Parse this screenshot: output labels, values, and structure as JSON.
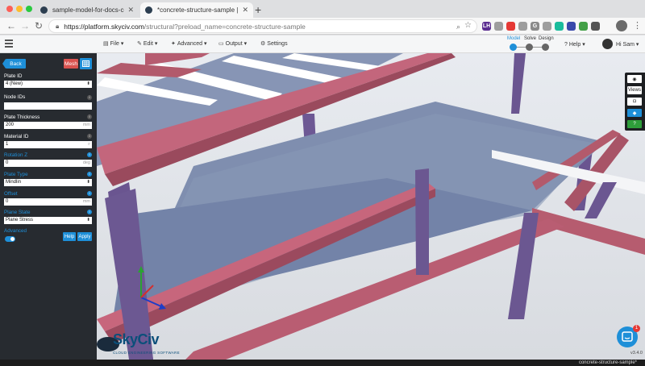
{
  "browser": {
    "tabs": [
      {
        "title": "sample-model-for-docs-concrete",
        "active": false
      },
      {
        "title": "*concrete-structure-sample | SkyCiv",
        "active": true
      }
    ],
    "url_host": "https://platform.skyciv.com",
    "url_path": "/structural?preload_name=concrete-structure-sample",
    "extensions": [
      {
        "label": "LH",
        "color": "#5b2d90"
      },
      {
        "label": "",
        "color": "#9e9e9e"
      },
      {
        "label": "",
        "color": "#e53935"
      },
      {
        "label": "",
        "color": "#9e9e9e"
      },
      {
        "label": "G",
        "color": "#8a8a8a"
      },
      {
        "label": "",
        "color": "#9e9e9e"
      },
      {
        "label": "",
        "color": "#1abc9c"
      },
      {
        "label": "",
        "color": "#3949ab"
      },
      {
        "label": "",
        "color": "#43a047"
      },
      {
        "label": "",
        "color": "#555555"
      }
    ]
  },
  "app": {
    "menus": [
      {
        "icon": "file-icon",
        "glyph": "▤",
        "label": "File"
      },
      {
        "icon": "edit-icon",
        "glyph": "✎",
        "label": "Edit"
      },
      {
        "icon": "wrench-icon",
        "glyph": "✦",
        "label": "Advanced"
      },
      {
        "icon": "monitor-icon",
        "glyph": "▭",
        "label": "Output"
      },
      {
        "icon": "gear-icon",
        "glyph": "⚙",
        "label": "Settings"
      }
    ],
    "modes": [
      {
        "label": "Model",
        "active": true
      },
      {
        "label": "Solve",
        "active": false
      },
      {
        "label": "Design",
        "active": false
      }
    ],
    "help_label": "Help",
    "user_label": "Hi Sam"
  },
  "panel": {
    "back_label": "Back",
    "mesh_label": "Mesh",
    "fields": {
      "plate_id": {
        "label": "Plate ID",
        "value": "4 (New)"
      },
      "node_ids": {
        "label": "Node IDs",
        "value": ""
      },
      "plate_thickness": {
        "label": "Plate Thickness",
        "value": "200",
        "unit": "mm"
      },
      "material_id": {
        "label": "Material ID",
        "value": "1"
      },
      "rotation_z": {
        "label": "Rotation Z",
        "value": "0",
        "unit": "deg"
      },
      "plate_type": {
        "label": "Plate Type",
        "value": "Mindlin"
      },
      "offset": {
        "label": "Offset",
        "value": "0",
        "unit": "mm"
      },
      "plane_state": {
        "label": "Plane State",
        "value": "Plane Stress"
      }
    },
    "advanced_label": "Advanced",
    "advanced_on": true,
    "help_button": "Help",
    "apply_button": "Apply"
  },
  "viewport": {
    "toolbar": {
      "eye_icon": "eye-icon",
      "views_label": "Views",
      "camera_icon": "camera-icon",
      "cube_icon": "cube-icon",
      "help_icon": "help-circle-icon"
    },
    "logo_text": "SkyCiv",
    "logo_sub": "CLOUD ENGINEERING SOFTWARE",
    "chat_badge": "1",
    "version": "v3.4.0"
  },
  "status": {
    "model_name": "concrete-structure-sample*"
  }
}
